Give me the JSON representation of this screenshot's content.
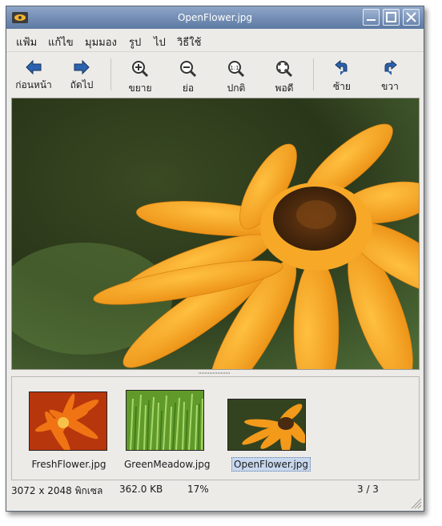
{
  "window": {
    "title": "OpenFlower.jpg"
  },
  "menu": [
    "แฟ้ม",
    "แก้ไข",
    "มุมมอง",
    "รูป",
    "ไป",
    "วิธีใช้"
  ],
  "toolbar": {
    "back": "ก่อนหน้า",
    "forward": "ถัดไป",
    "zoom_in": "ขยาย",
    "zoom_out": "ย่อ",
    "normal": "ปกติ",
    "fit": "พอดี",
    "rotate_left": "ซ้าย",
    "rotate_right": "ขวา"
  },
  "thumbnails": [
    {
      "label": "FreshFlower.jpg"
    },
    {
      "label": "GreenMeadow.jpg"
    },
    {
      "label": "OpenFlower.jpg",
      "selected": true
    }
  ],
  "status": {
    "dimensions": "3072  x  2048  พิกเซล",
    "size": "362.0  KB",
    "zoom": "17%",
    "position": "3  /  3"
  },
  "colors": {
    "titlebar": "#6a86ad",
    "icon_blue": "#2c63b0",
    "flower": "#f39a1a",
    "flower_center": "#4a2a10",
    "background_green": "#2f3f1e"
  }
}
